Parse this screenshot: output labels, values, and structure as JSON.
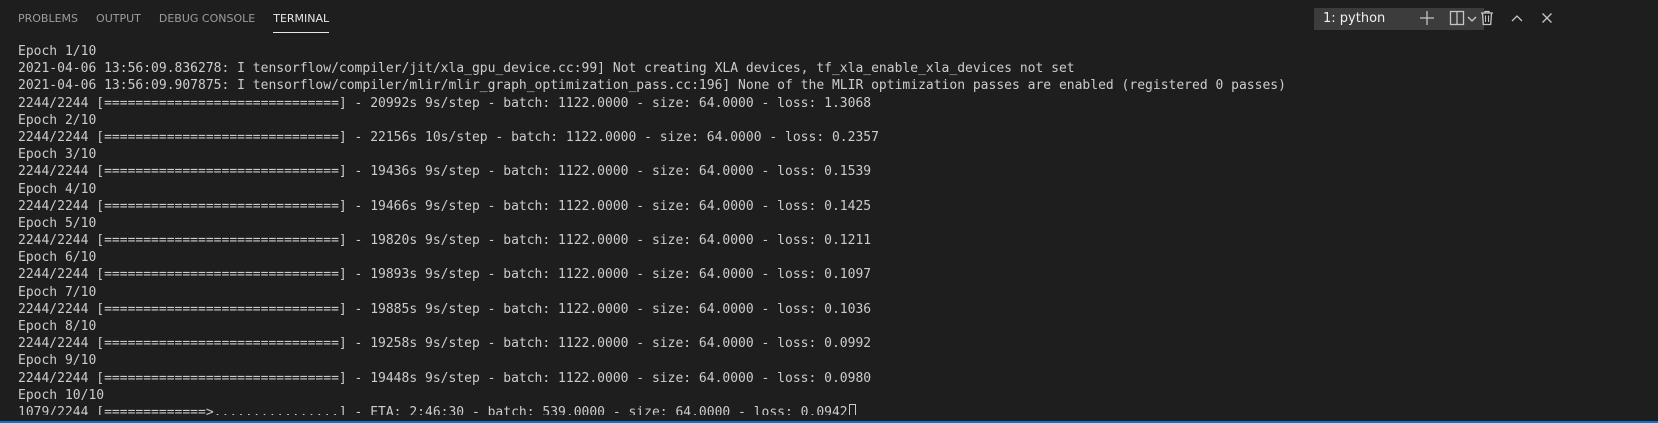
{
  "panel": {
    "tabs": [
      {
        "label": "PROBLEMS"
      },
      {
        "label": "OUTPUT"
      },
      {
        "label": "DEBUG CONSOLE"
      },
      {
        "label": "TERMINAL"
      }
    ],
    "active_tab": "TERMINAL",
    "terminal_selector": {
      "value": "1: python"
    },
    "actions": [
      "new-terminal-icon",
      "split-terminal-icon",
      "trash-icon",
      "maximize-panel-icon",
      "close-icon"
    ]
  },
  "terminal": {
    "lines": [
      "Epoch 1/10",
      "2021-04-06 13:56:09.836278: I tensorflow/compiler/jit/xla_gpu_device.cc:99] Not creating XLA devices, tf_xla_enable_xla_devices not set",
      "2021-04-06 13:56:09.907875: I tensorflow/compiler/mlir/mlir_graph_optimization_pass.cc:196] None of the MLIR optimization passes are enabled (registered 0 passes)",
      "2244/2244 [==============================] - 20992s 9s/step - batch: 1122.0000 - size: 64.0000 - loss: 1.3068",
      "Epoch 2/10",
      "2244/2244 [==============================] - 22156s 10s/step - batch: 1122.0000 - size: 64.0000 - loss: 0.2357",
      "Epoch 3/10",
      "2244/2244 [==============================] - 19436s 9s/step - batch: 1122.0000 - size: 64.0000 - loss: 0.1539",
      "Epoch 4/10",
      "2244/2244 [==============================] - 19466s 9s/step - batch: 1122.0000 - size: 64.0000 - loss: 0.1425",
      "Epoch 5/10",
      "2244/2244 [==============================] - 19820s 9s/step - batch: 1122.0000 - size: 64.0000 - loss: 0.1211",
      "Epoch 6/10",
      "2244/2244 [==============================] - 19893s 9s/step - batch: 1122.0000 - size: 64.0000 - loss: 0.1097",
      "Epoch 7/10",
      "2244/2244 [==============================] - 19885s 9s/step - batch: 1122.0000 - size: 64.0000 - loss: 0.1036",
      "Epoch 8/10",
      "2244/2244 [==============================] - 19258s 9s/step - batch: 1122.0000 - size: 64.0000 - loss: 0.0992",
      "Epoch 9/10",
      "2244/2244 [==============================] - 19448s 9s/step - batch: 1122.0000 - size: 64.0000 - loss: 0.0980",
      "Epoch 10/10",
      "1079/2244 [=============>................] - ETA: 2:46:30 - batch: 539.0000 - size: 64.0000 - loss: 0.0942"
    ]
  },
  "colors": {
    "background": "#1e1e1e",
    "text": "#cccccc",
    "accent": "#007acc"
  }
}
